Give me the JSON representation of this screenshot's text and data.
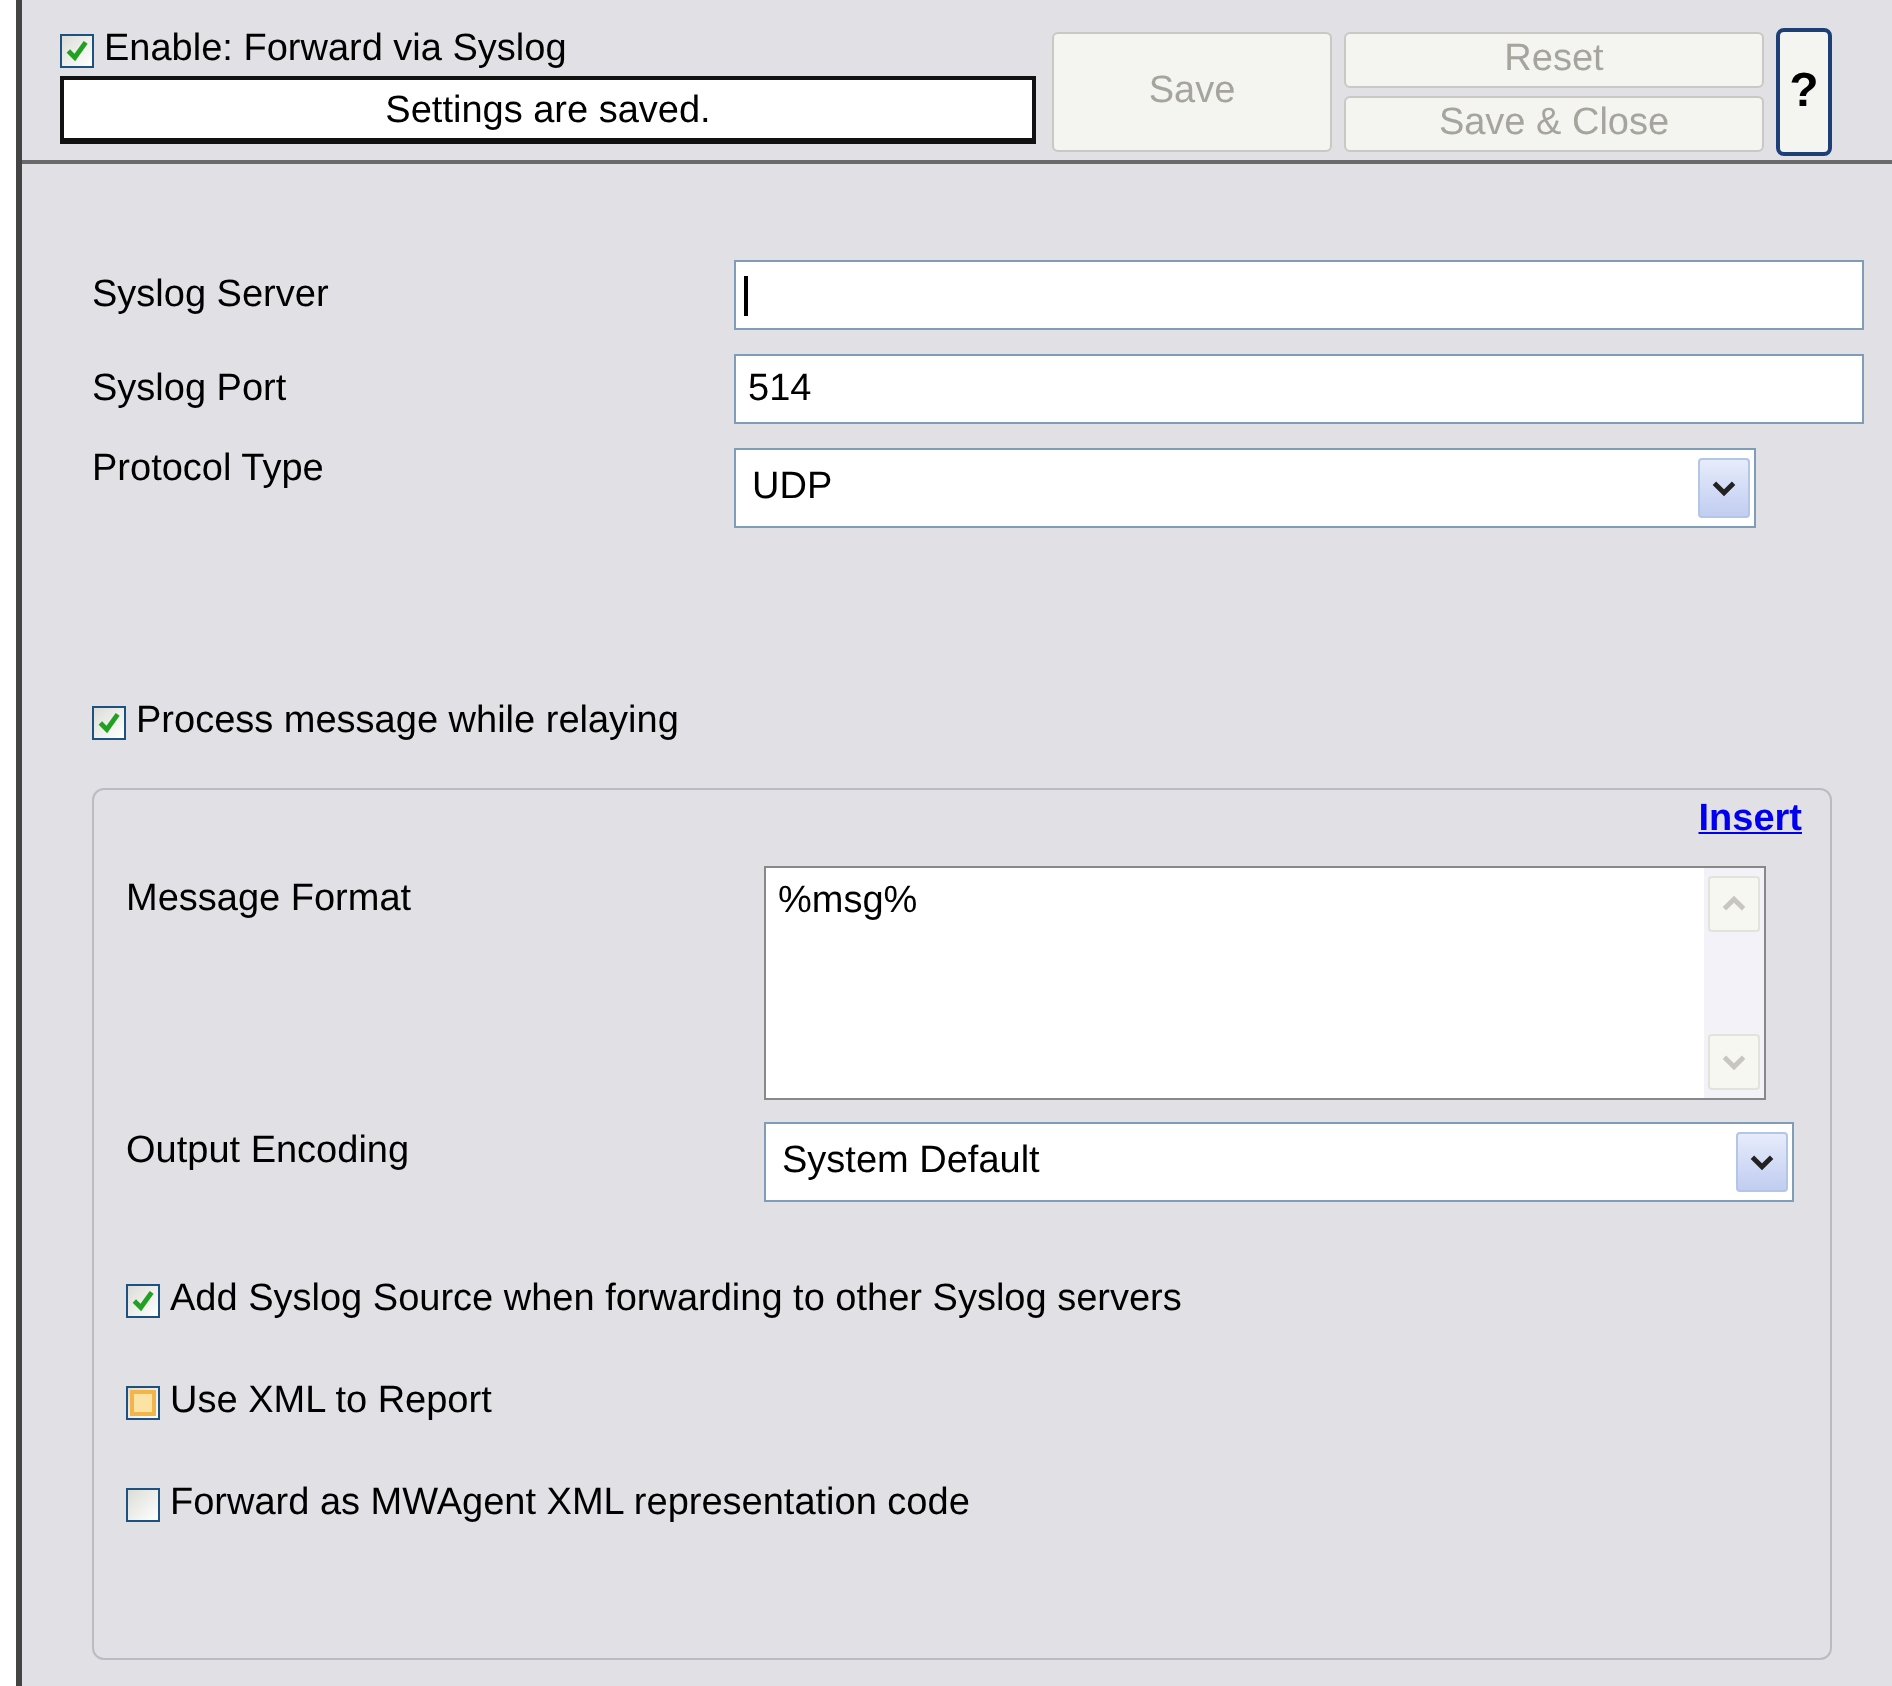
{
  "header": {
    "enable": {
      "label": "Enable: Forward via Syslog",
      "checked": true
    },
    "status": "Settings are saved.",
    "buttons": [
      {
        "kind": "save",
        "label": "Save",
        "disabled": true
      },
      {
        "kind": "reset",
        "label": "Reset",
        "disabled": true
      },
      {
        "kind": "save_close",
        "label": "Save & Close",
        "disabled": true
      },
      {
        "kind": "help",
        "label": "?",
        "disabled": false
      }
    ]
  },
  "fields": [
    {
      "kind": "text",
      "label": "Syslog Server",
      "focused": true
    },
    {
      "kind": "text",
      "label": "Syslog Port",
      "value": "514",
      "focused": false
    },
    {
      "kind": "select",
      "label": "Protocol Type",
      "value": "UDP"
    }
  ],
  "process": {
    "label": "Process message while relaying",
    "checked": true
  },
  "group": {
    "insert_link": "Insert",
    "message_format": {
      "label": "Message Format",
      "value": "%msg%"
    },
    "output_encoding": {
      "label": "Output Encoding",
      "value": "System Default"
    },
    "options": [
      {
        "label": "Add Syslog Source when forwarding to other Syslog servers",
        "checked": true,
        "hovered": false
      },
      {
        "label": "Use XML to Report",
        "checked": false,
        "hovered": true
      },
      {
        "label": "Forward as MWAgent XML representation code",
        "checked": false,
        "hovered": false
      }
    ]
  }
}
